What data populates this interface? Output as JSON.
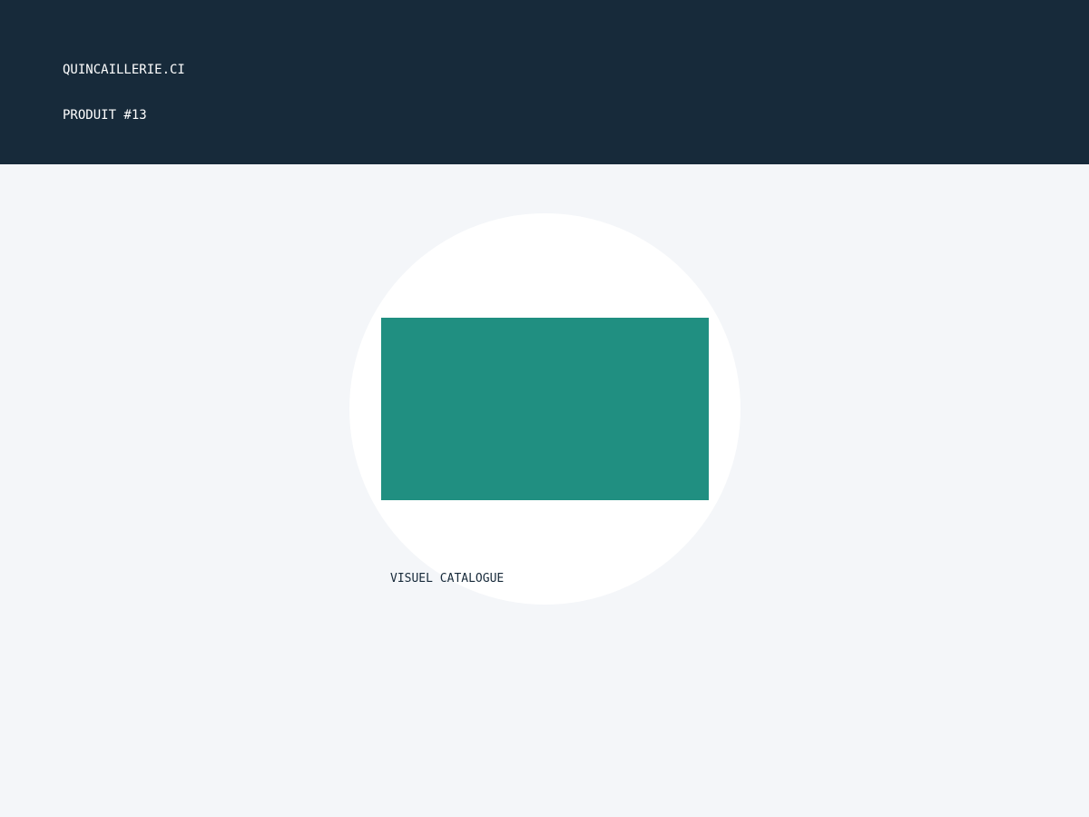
{
  "header": {
    "brand": "QUINCAILLERIE.CI",
    "product_id": "PRODUIT #13",
    "background_color": "#172a3a"
  },
  "main": {
    "background_color": "#f4f6f9",
    "visual": {
      "caption": "VISUEL CATALOGUE",
      "circle_color": "#ffffff",
      "block_color": "#208f81"
    }
  }
}
